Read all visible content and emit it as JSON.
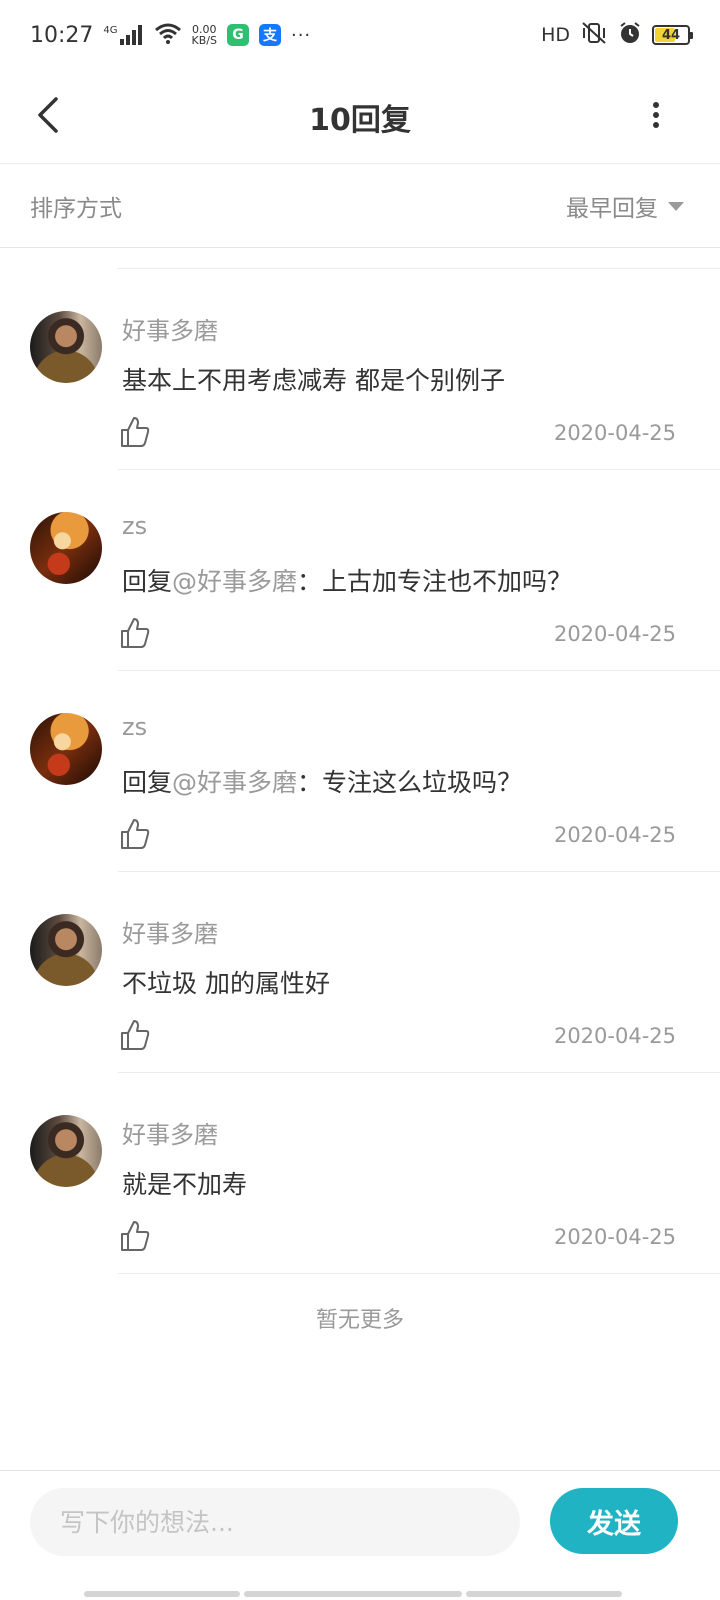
{
  "status_bar": {
    "time": "10:27",
    "network_type": "4G",
    "net_speed_value": "0.00",
    "net_speed_unit": "KB/S",
    "hd_label": "HD",
    "battery_level": "44",
    "overflow_dots": "···"
  },
  "header": {
    "title": "10回复"
  },
  "sort_bar": {
    "label": "排序方式",
    "selected": "最早回复"
  },
  "replies": [
    {
      "author": "好事多磨",
      "prefix": "",
      "mention": "",
      "text": "基本上不用考虑减寿  都是个别例子",
      "date": "2020-04-25"
    },
    {
      "author": "zs",
      "prefix": "回复",
      "mention": "@好事多磨",
      "text": "：上古加专注也不加吗？",
      "date": "2020-04-25"
    },
    {
      "author": "zs",
      "prefix": "回复",
      "mention": "@好事多磨",
      "text": "：专注这么垃圾吗？",
      "date": "2020-04-25"
    },
    {
      "author": "好事多磨",
      "prefix": "",
      "mention": "",
      "text": "不垃圾  加的属性好",
      "date": "2020-04-25"
    },
    {
      "author": "好事多磨",
      "prefix": "",
      "mention": "",
      "text": "就是不加寿",
      "date": "2020-04-25"
    }
  ],
  "footer_note": "暂无更多",
  "composer": {
    "placeholder": "写下你的想法...",
    "send_label": "发送"
  },
  "colors": {
    "accent": "#1fb3c3",
    "muted_text": "#9a9a9a",
    "body_text": "#333333"
  }
}
